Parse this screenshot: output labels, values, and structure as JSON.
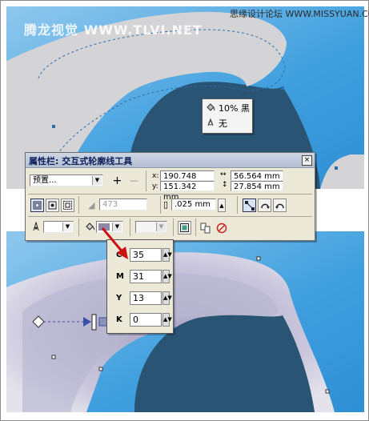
{
  "watermark": {
    "left_text": "腾龙视觉 WWW.TLVI.NET",
    "right_text": "思缘设计论坛 WWW.MISSYUAN.COM"
  },
  "context_popup": {
    "items": [
      {
        "icon": "fill-bucket-icon",
        "label": "10% 黑"
      },
      {
        "icon": "no-fill-icon",
        "label": "无"
      }
    ]
  },
  "toolbar": {
    "title": "属性栏: 交互式轮廓线工具",
    "close_glyph": "×",
    "preset": {
      "value": "预置...",
      "add_glyph": "+",
      "remove_glyph": "—"
    },
    "position": {
      "x_label": "x:",
      "x_value": "190.748 mm",
      "y_label": "y:",
      "y_value": "151.342 mm"
    },
    "size": {
      "w_value": "56.564 mm",
      "h_value": "27.854 mm"
    },
    "steps": {
      "value": "473"
    },
    "offset": {
      "value": ".025 mm"
    }
  },
  "cmyk_popup": {
    "rows": [
      {
        "key": "C",
        "value": "35"
      },
      {
        "key": "M",
        "value": "31"
      },
      {
        "key": "Y",
        "value": "13"
      },
      {
        "key": "K",
        "value": "0"
      }
    ],
    "spin_glyph": "▲▼"
  },
  "colors": {
    "sky_blue": "#3f9fde",
    "dark_teal": "#2a5474",
    "shape_gray": "#d4d4d6",
    "lavender": "#aaa6c6",
    "toolbar_bg": "#ece9d8",
    "arrow_red": "#cc1111"
  }
}
